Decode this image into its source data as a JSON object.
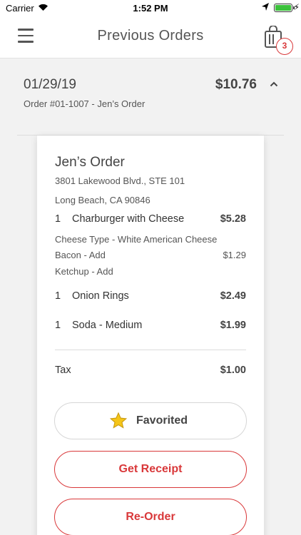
{
  "status_bar": {
    "carrier": "Carrier",
    "time": "1:52 PM"
  },
  "navbar": {
    "title": "Previous Orders",
    "cart_count": "3"
  },
  "order": {
    "date": "01/29/19",
    "total": "$10.76",
    "subtitle": "Order #01-1007 - Jen’s Order"
  },
  "receipt": {
    "title": "Jen’s Order",
    "address_line1": "3801 Lakewood Blvd., STE 101",
    "address_line2": "Long Beach, CA 90846",
    "items": [
      {
        "qty": "1",
        "name": "Charburger with Cheese",
        "price": "$5.28"
      },
      {
        "qty": "1",
        "name": "Onion Rings",
        "price": "$2.49"
      },
      {
        "qty": "1",
        "name": "Soda - Medium",
        "price": "$1.99"
      }
    ],
    "modifiers": [
      {
        "label": "Cheese Type - White American Cheese",
        "price": ""
      },
      {
        "label": "Bacon - Add",
        "price": "$1.29"
      },
      {
        "label": "Ketchup - Add",
        "price": ""
      }
    ],
    "tax_label": "Tax",
    "tax_value": "$1.00"
  },
  "actions": {
    "favorited_label": "Favorited",
    "get_receipt_label": "Get Receipt",
    "reorder_label": "Re-Order"
  },
  "colors": {
    "accent": "#d9383a",
    "star": "#f5c518"
  },
  "icons": [
    "wifi-icon",
    "location-icon",
    "battery-icon",
    "menu-icon",
    "shopping-bag-icon",
    "chevron-up-icon",
    "star-icon"
  ]
}
